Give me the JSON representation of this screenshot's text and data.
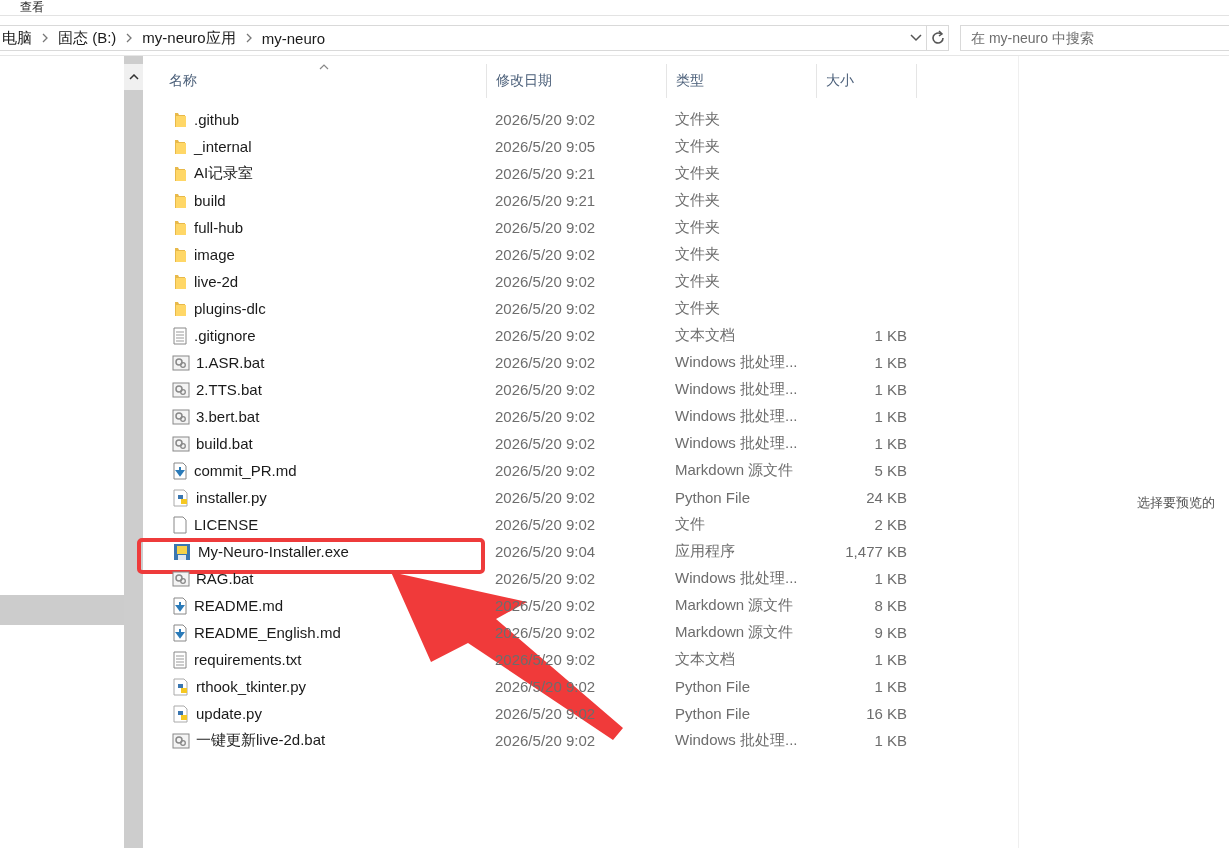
{
  "menu": {
    "label": "查看"
  },
  "breadcrumb": [
    "电脑",
    "固态 (B:)",
    "my-neuro应用",
    "my-neuro"
  ],
  "search": {
    "placeholder": "在 my-neuro 中搜索"
  },
  "columns": [
    {
      "label": "名称",
      "sorted": true
    },
    {
      "label": "修改日期",
      "sorted": false
    },
    {
      "label": "类型",
      "sorted": false
    },
    {
      "label": "大小",
      "sorted": false
    }
  ],
  "files": [
    {
      "kind": "folder",
      "name": ".github",
      "modified": "2026/5/20 9:02",
      "type": "文件夹",
      "annotated": false
    },
    {
      "kind": "folder",
      "name": "_internal",
      "modified": "2026/5/20 9:05",
      "type": "文件夹",
      "annotated": false
    },
    {
      "kind": "folder",
      "name": "AI记录室",
      "modified": "2026/5/20 9:21",
      "type": "文件夹",
      "annotated": false
    },
    {
      "kind": "folder",
      "name": "build",
      "modified": "2026/5/20 9:21",
      "type": "文件夹",
      "annotated": false
    },
    {
      "kind": "folder",
      "name": "full-hub",
      "modified": "2026/5/20 9:02",
      "type": "文件夹",
      "annotated": false
    },
    {
      "kind": "folder",
      "name": "image",
      "modified": "2026/5/20 9:02",
      "type": "文件夹",
      "annotated": false
    },
    {
      "kind": "folder",
      "name": "live-2d",
      "modified": "2026/5/20 9:02",
      "type": "文件夹",
      "annotated": false
    },
    {
      "kind": "folder",
      "name": "plugins-dlc",
      "modified": "2026/5/20 9:02",
      "type": "文件夹",
      "annotated": false
    },
    {
      "kind": "text",
      "name": ".gitignore",
      "modified": "2026/5/20 9:02",
      "type": "文本文档",
      "size": "1 KB",
      "annotated": false
    },
    {
      "kind": "batch",
      "name": "1.ASR.bat",
      "modified": "2026/5/20 9:02",
      "type": "Windows 批处理...",
      "size": "1 KB",
      "annotated": false
    },
    {
      "kind": "batch",
      "name": "2.TTS.bat",
      "modified": "2026/5/20 9:02",
      "type": "Windows 批处理...",
      "size": "1 KB",
      "annotated": false
    },
    {
      "kind": "batch",
      "name": "3.bert.bat",
      "modified": "2026/5/20 9:02",
      "type": "Windows 批处理...",
      "size": "1 KB",
      "annotated": false
    },
    {
      "kind": "batch",
      "name": "build.bat",
      "modified": "2026/5/20 9:02",
      "type": "Windows 批处理...",
      "size": "1 KB",
      "annotated": false
    },
    {
      "kind": "markdown",
      "name": "commit_PR.md",
      "modified": "2026/5/20 9:02",
      "type": "Markdown 源文件",
      "size": "5 KB",
      "annotated": false
    },
    {
      "kind": "python",
      "name": "installer.py",
      "modified": "2026/5/20 9:02",
      "type": "Python File",
      "size": "24 KB",
      "annotated": false
    },
    {
      "kind": "blank",
      "name": "LICENSE",
      "modified": "2026/5/20 9:02",
      "type": "文件",
      "size": "2 KB",
      "annotated": false
    },
    {
      "kind": "exe",
      "name": "My-Neuro-Installer.exe",
      "modified": "2026/5/20 9:04",
      "type": "应用程序",
      "size": "1,477 KB",
      "annotated": true
    },
    {
      "kind": "batch",
      "name": "RAG.bat",
      "modified": "2026/5/20 9:02",
      "type": "Windows 批处理...",
      "size": "1 KB",
      "annotated": false
    },
    {
      "kind": "markdown",
      "name": "README.md",
      "modified": "2026/5/20 9:02",
      "type": "Markdown 源文件",
      "size": "8 KB",
      "annotated": false
    },
    {
      "kind": "markdown",
      "name": "README_English.md",
      "modified": "2026/5/20 9:02",
      "type": "Markdown 源文件",
      "size": "9 KB",
      "annotated": false
    },
    {
      "kind": "text",
      "name": "requirements.txt",
      "modified": "2026/5/20 9:02",
      "type": "文本文档",
      "size": "1 KB",
      "annotated": false
    },
    {
      "kind": "python",
      "name": "rthook_tkinter.py",
      "modified": "2026/5/20 9:02",
      "type": "Python File",
      "size": "1 KB",
      "annotated": false
    },
    {
      "kind": "python",
      "name": "update.py",
      "modified": "2026/5/20 9:02",
      "type": "Python File",
      "size": "16 KB",
      "annotated": false
    },
    {
      "kind": "batch",
      "name": "一键更新live-2d.bat",
      "modified": "2026/5/20 9:02",
      "type": "Windows 批处理...",
      "size": "1 KB",
      "annotated": false
    }
  ],
  "preview": {
    "message": "选择要预览的"
  }
}
